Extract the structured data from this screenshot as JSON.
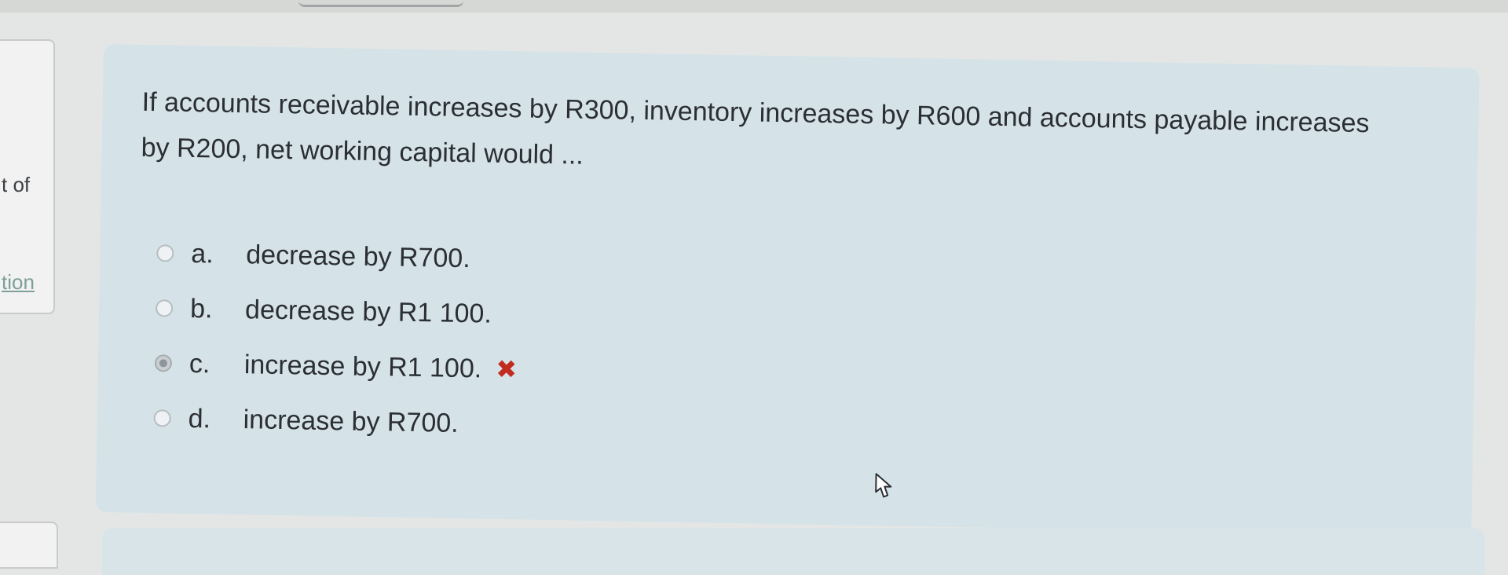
{
  "sidebar": {
    "fragment_1": "t of",
    "fragment_2": "tion"
  },
  "question": {
    "text": "If accounts receivable increases by R300, inventory increases by R600 and accounts payable increases by R200, net working capital would ...",
    "answers": [
      {
        "letter": "a.",
        "text": "decrease by R700.",
        "selected": false
      },
      {
        "letter": "b.",
        "text": "decrease by R1 100.",
        "selected": false
      },
      {
        "letter": "c.",
        "text": "increase by R1 100.",
        "selected": true,
        "mark": "✖"
      },
      {
        "letter": "d.",
        "text": "increase by R700.",
        "selected": false
      }
    ]
  },
  "colors": {
    "card_background": "#d5e3e8",
    "incorrect_mark": "#c22b1f"
  },
  "icons": {
    "incorrect": "incorrect-icon",
    "cursor": "mouse-pointer-icon",
    "radio": "radio-button-icon"
  }
}
